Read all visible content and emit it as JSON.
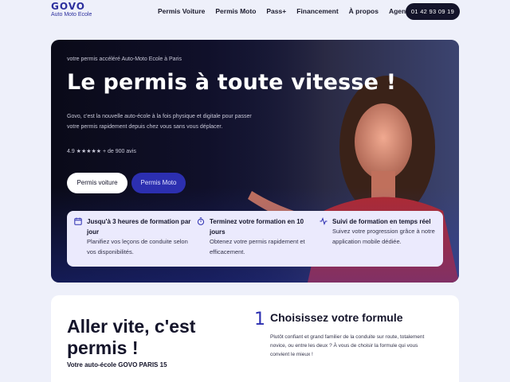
{
  "header": {
    "logo": "GOVO",
    "logo_sub": "Auto Moto Ecole",
    "nav": [
      "Permis Voiture",
      "Permis Moto",
      "Pass+",
      "Financement",
      "À propos",
      "Agences"
    ],
    "phone": "01 42 93 09 19"
  },
  "hero": {
    "kicker": "votre permis accéléré Auto-Moto Ecole à Paris",
    "title": "Le permis à toute vitesse !",
    "description": "Govo, c'est la nouvelle auto-école à la fois physique et digitale pour passer votre permis rapidement depuis chez vous sans vous déplacer.",
    "rating": "4.9 ★★★★★ + de 900 avis",
    "btn_voiture": "Permis voiture",
    "btn_moto": "Permis Moto"
  },
  "features": [
    {
      "icon": "calendar-icon",
      "title": "Jusqu'à 3 heures de formation par jour",
      "desc": "Planifiez vos leçons de conduite selon vos disponibilités."
    },
    {
      "icon": "stopwatch-icon",
      "title": "Terminez votre formation en 10 jours",
      "desc": "Obtenez votre permis rapidement et efficacement."
    },
    {
      "icon": "activity-icon",
      "title": "Suivi de formation en temps réel",
      "desc": "Suivez votre progression grâce à notre application mobile dédiée."
    }
  ],
  "section": {
    "title": "Aller vite, c'est permis !",
    "subtitle": "Votre auto-école GOVO PARIS 15",
    "step_number": "1",
    "step_title": "Choisissez votre formule",
    "step_desc": "Plutôt confiant et grand familier de la conduite sur route, totalement novice, ou entre les deux ? À vous de choisir la formule qui vous convient le mieux !"
  },
  "colors": {
    "accent": "#2c2fb0",
    "dark": "#14142a",
    "background": "#eef0fa",
    "feature_bg": "#ebeafd"
  }
}
